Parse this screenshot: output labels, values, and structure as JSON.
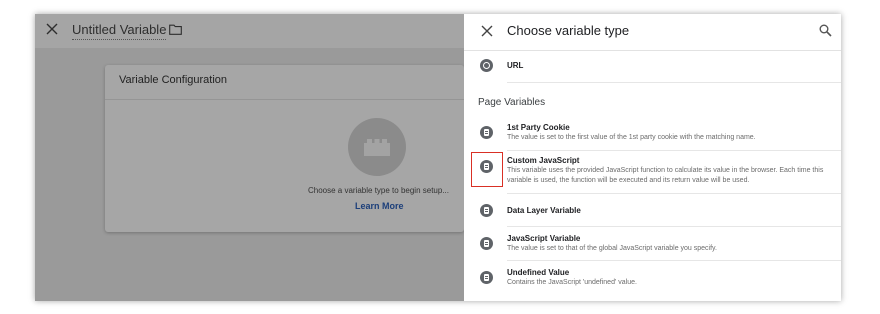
{
  "editor": {
    "title": "Untitled Variable",
    "card_title": "Variable Configuration",
    "hint": "Choose a variable type to begin setup...",
    "learn_more": "Learn More"
  },
  "panel": {
    "title": "Choose variable type",
    "section": "Page Variables",
    "url_item": {
      "name": "URL",
      "icon": "globe-icon"
    },
    "items": [
      {
        "name": "1st Party Cookie",
        "desc": "The value is set to the first value of the 1st party cookie with the matching name.",
        "icon": "document-icon"
      },
      {
        "name": "Custom JavaScript",
        "desc": "This variable uses the provided JavaScript function to calculate its value in the browser. Each time this variable is used, the function will be executed and its return value will be used.",
        "icon": "document-icon"
      },
      {
        "name": "Data Layer Variable",
        "desc": "",
        "icon": "document-icon"
      },
      {
        "name": "JavaScript Variable",
        "desc": "The value is set to that of the global JavaScript variable you specify.",
        "icon": "document-icon"
      },
      {
        "name": "Undefined Value",
        "desc": "Contains the JavaScript 'undefined' value.",
        "icon": "document-icon"
      }
    ]
  },
  "colors": {
    "highlight": "#d93025",
    "link": "#1c3f7a",
    "icon": "#5f6368"
  }
}
